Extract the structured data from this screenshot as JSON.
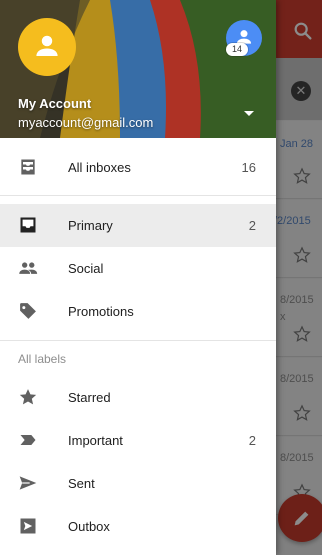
{
  "background": {
    "dates": [
      "Jan 28",
      "/2/2015",
      "8/2015",
      "8/2015",
      "8/2015"
    ],
    "snippet": "x"
  },
  "account": {
    "name": "My Account",
    "email": "myaccount@gmail.com",
    "secondary_badge": "14"
  },
  "nav": {
    "all_inboxes": {
      "label": "All inboxes",
      "count": "16"
    },
    "primary": {
      "label": "Primary",
      "count": "2"
    },
    "social": {
      "label": "Social"
    },
    "promotions": {
      "label": "Promotions"
    }
  },
  "labels_section": {
    "heading": "All labels",
    "items": {
      "starred": {
        "label": "Starred"
      },
      "important": {
        "label": "Important",
        "count": "2"
      },
      "sent": {
        "label": "Sent"
      },
      "outbox": {
        "label": "Outbox"
      }
    }
  },
  "colors": {
    "app_bar": "#d23f31",
    "avatar_primary": "#f5bd1e",
    "avatar_secondary": "#4c8df5",
    "selected_row": "#ececec"
  },
  "icons": {
    "search": "search-icon",
    "close": "close-icon",
    "compose": "pencil-icon",
    "all_inboxes": "inbox-stack-icon",
    "primary": "inbox-icon",
    "social": "people-icon",
    "promotions": "tag-icon",
    "starred": "star-icon",
    "important": "important-icon",
    "sent": "send-icon",
    "outbox": "outbox-icon"
  }
}
